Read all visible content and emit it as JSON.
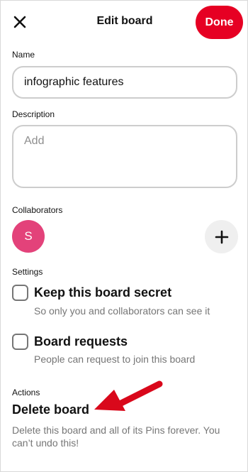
{
  "header": {
    "title": "Edit board",
    "done_label": "Done",
    "close_icon": "close-icon"
  },
  "name": {
    "label": "Name",
    "value": "infographic features"
  },
  "description": {
    "label": "Description",
    "placeholder": "Add"
  },
  "collaborators": {
    "label": "Collaborators",
    "avatar_initial": "S",
    "avatar_color": "#e3427a",
    "add_icon": "plus-icon"
  },
  "settings": {
    "label": "Settings",
    "options": [
      {
        "title": "Keep this board secret",
        "description": "So only you and collaborators can see it",
        "checked": false
      },
      {
        "title": "Board requests",
        "description": "People can request to join this board",
        "checked": false
      }
    ]
  },
  "actions": {
    "label": "Actions",
    "delete_title": "Delete board",
    "delete_description": "Delete this board and all of its Pins forever. You can’t undo this!"
  },
  "colors": {
    "accent": "#e60023",
    "annotation_arrow": "#d9081b"
  }
}
